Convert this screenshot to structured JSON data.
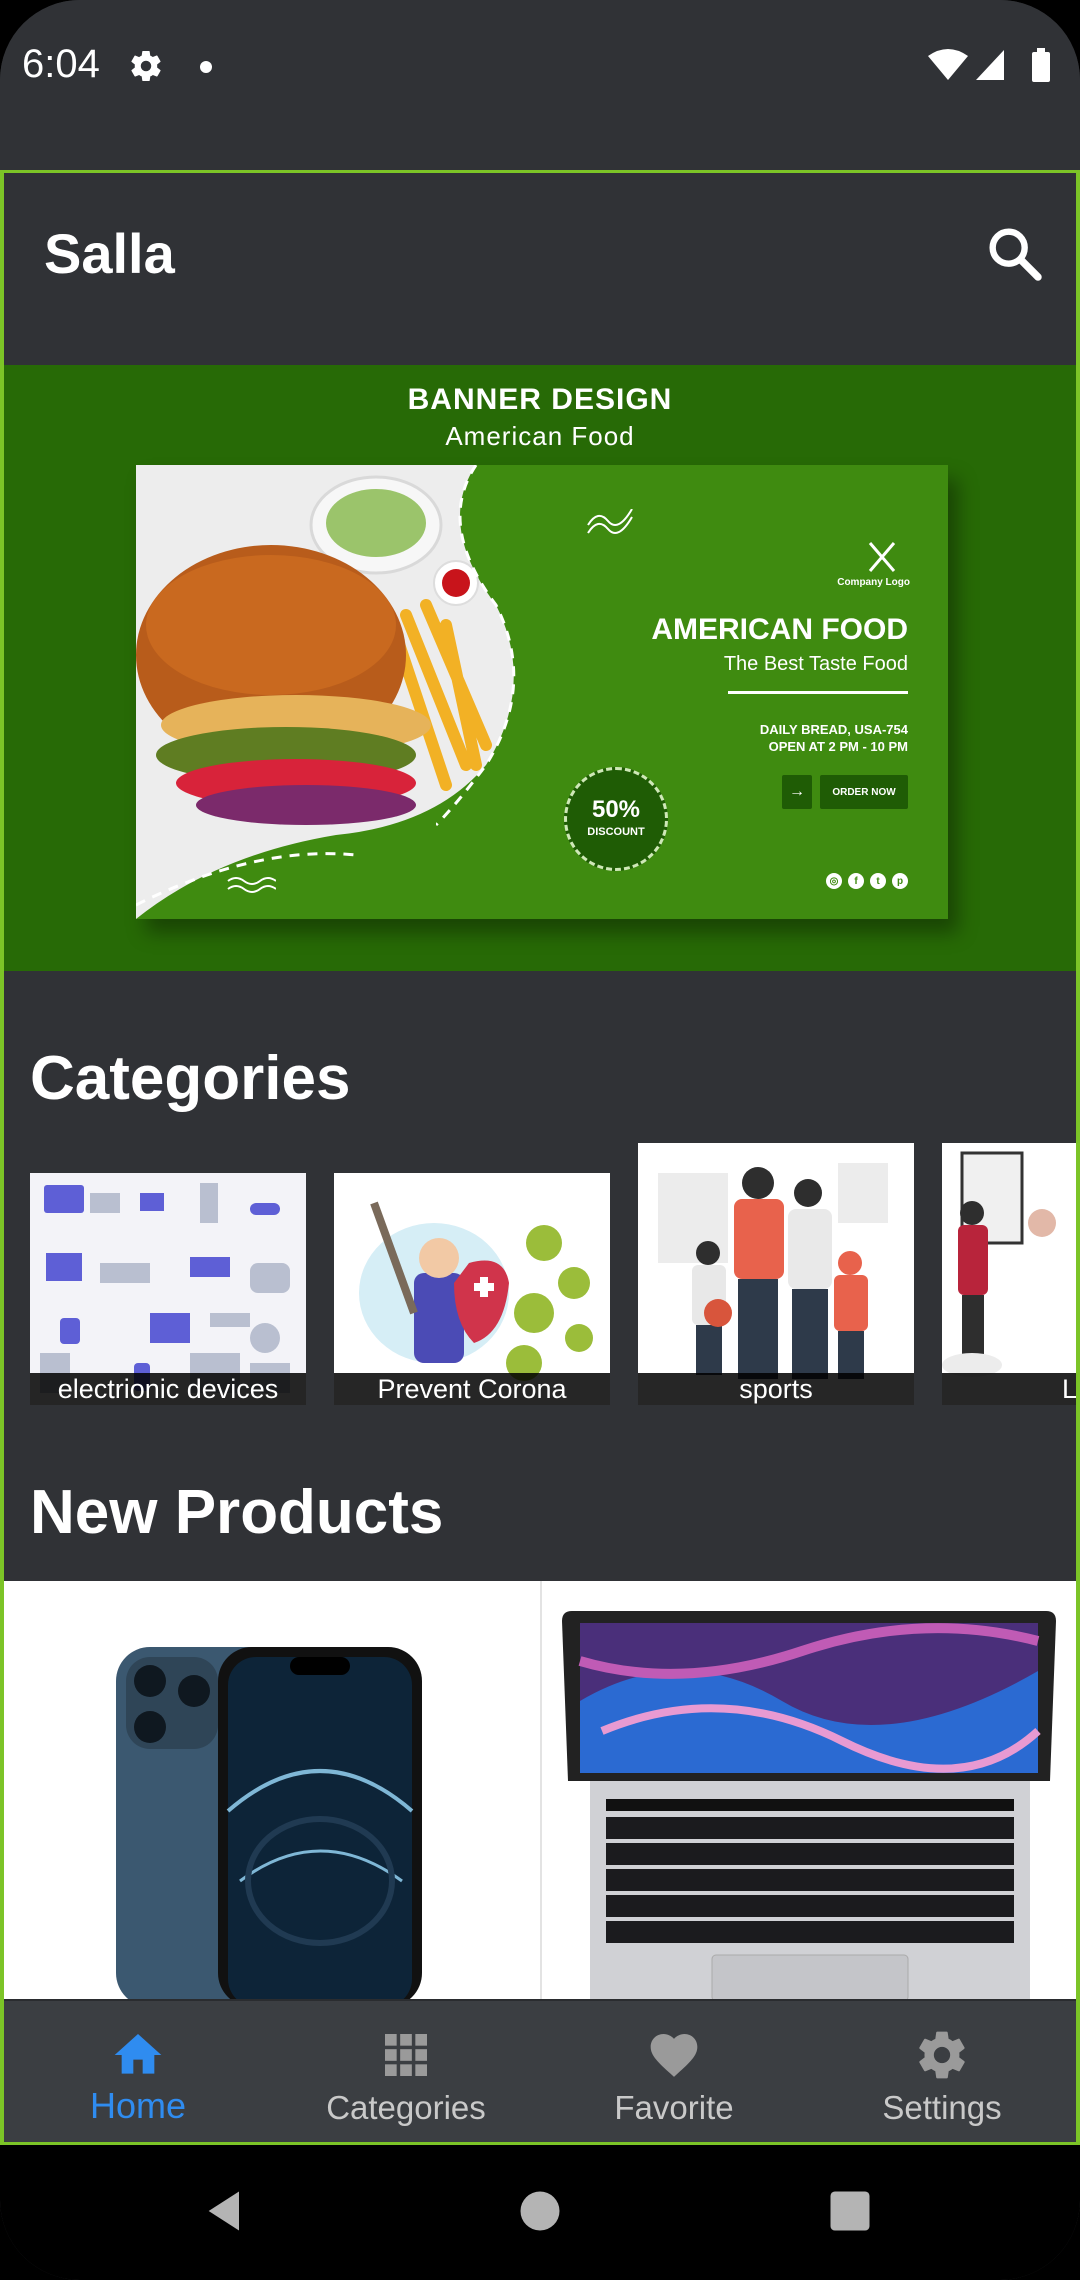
{
  "status_bar": {
    "time": "6:04"
  },
  "app_bar": {
    "title": "Salla"
  },
  "banner": {
    "heading": "BANNER DESIGN",
    "subheading": "American  Food",
    "card": {
      "company_logo_text": "Company Logo",
      "title": "AMERICAN FOOD",
      "subtitle": "The Best Taste Food",
      "address": "DAILY BREAD, USA-754",
      "hours": "OPEN AT  2 PM - 10 PM",
      "order_button": "ORDER NOW",
      "order_arrow": "→",
      "discount_percent": "50%",
      "discount_label": "DISCOUNT",
      "social_icons": [
        "instagram-icon",
        "facebook-icon",
        "twitter-icon",
        "pinterest-icon"
      ]
    }
  },
  "categories": {
    "title": "Categories",
    "items": [
      {
        "label": "electrionic devices"
      },
      {
        "label": "Prevent Corona"
      },
      {
        "label": "sports"
      },
      {
        "label": "Lig"
      }
    ]
  },
  "new_products": {
    "title": "New Products",
    "items": [
      {
        "image": "iphone-product-image"
      },
      {
        "image": "macbook-product-image"
      }
    ]
  },
  "bottom_nav": {
    "items": [
      {
        "label": "Home",
        "icon": "home-icon",
        "active": true
      },
      {
        "label": "Categories",
        "icon": "grid-icon",
        "active": false
      },
      {
        "label": "Favorite",
        "icon": "heart-icon",
        "active": false
      },
      {
        "label": "Settings",
        "icon": "gear-icon",
        "active": false
      }
    ]
  },
  "colors": {
    "background": "#303236",
    "accent_frame": "#7cc427",
    "banner_green": "#276a06",
    "active_nav": "#2f8cf0",
    "inactive_nav": "#c9c9c9"
  }
}
